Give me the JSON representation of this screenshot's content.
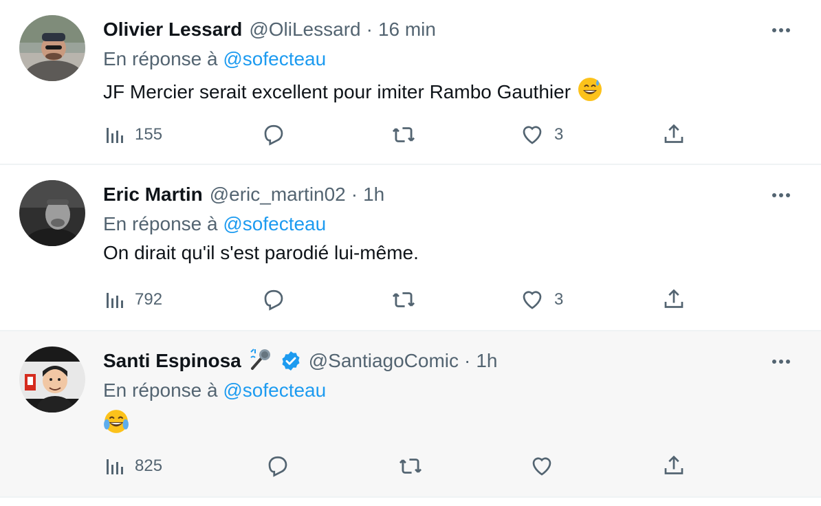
{
  "tweets": [
    {
      "name": "Olivier Lessard",
      "handle": "@OliLessard",
      "separator": "·",
      "time": "16 min",
      "reply_prefix": "En réponse à",
      "reply_to": "@sofecteau",
      "text": "JF Mercier serait excellent pour imiter Rambo Gauthier",
      "text_emoji": "grinning-sweat-emoji",
      "views": "155",
      "replies": "",
      "retweets": "",
      "likes": "3"
    },
    {
      "name": "Eric Martin",
      "handle": "@eric_martin02",
      "separator": "·",
      "time": "1h",
      "reply_prefix": "En réponse à",
      "reply_to": "@sofecteau",
      "text": "On dirait qu'il s'est parodié lui-même.",
      "views": "792",
      "replies": "",
      "retweets": "",
      "likes": "3"
    },
    {
      "name": "Santi Espinosa",
      "name_emoji": "microphone-emoji",
      "verified": true,
      "handle": "@SantiagoComic",
      "separator": "·",
      "time": "1h",
      "reply_prefix": "En réponse à",
      "reply_to": "@sofecteau",
      "text": "",
      "text_emoji": "tears-of-joy-emoji",
      "views": "825",
      "replies": "",
      "retweets": "",
      "likes": ""
    }
  ],
  "colors": {
    "text": "#0f1419",
    "muted": "#536471",
    "link": "#1d9bf0",
    "verified": "#1d9bf0",
    "divider": "#eff3f4",
    "highlight_bg": "#f7f7f7"
  }
}
